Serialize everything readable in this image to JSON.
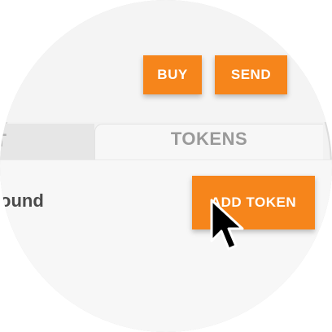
{
  "header": {
    "buy_label": "BUY",
    "send_label": "SEND"
  },
  "tabs": {
    "left_partial_label": "T",
    "tokens_label": "TOKENS"
  },
  "main": {
    "empty_message_partial": "ound",
    "add_token_label": "ADD TOKEN"
  },
  "colors": {
    "accent": "#f6851b",
    "background": "#f7f7f7",
    "tab_text": "#9a9a9a",
    "body_text": "#4a4a4a"
  },
  "icons": {
    "cursor": "arrow-cursor-icon"
  }
}
